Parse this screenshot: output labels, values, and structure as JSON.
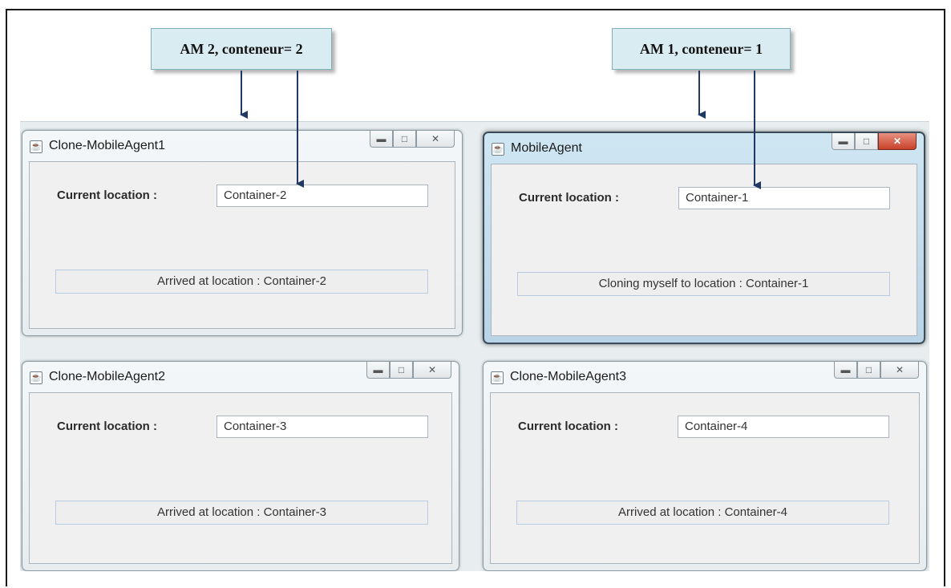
{
  "callouts": [
    {
      "text": "AM 2, conteneur= 2"
    },
    {
      "text": "AM 1, conteneur= 1"
    }
  ],
  "windows": [
    {
      "title": "Clone-MobileAgent1",
      "location_label": "Current location :",
      "location_value": "Container-2",
      "status": "Arrived at location : Container-2"
    },
    {
      "title": "MobileAgent",
      "location_label": "Current location :",
      "location_value": "Container-1",
      "status": "Cloning myself to location : Container-1"
    },
    {
      "title": "Clone-MobileAgent2",
      "location_label": "Current location :",
      "location_value": "Container-3",
      "status": "Arrived at location : Container-3"
    },
    {
      "title": "Clone-MobileAgent3",
      "location_label": "Current location :",
      "location_value": "Container-4",
      "status": "Arrived at location : Container-4"
    }
  ],
  "icons": {
    "app": "java-app-icon",
    "minimize": "minimize-icon",
    "maximize": "maximize-icon",
    "close": "close-icon"
  },
  "colors": {
    "callout_bg": "#d9ecf1",
    "arrow": "#1f3864",
    "active_frame": "#b9d4e6"
  }
}
